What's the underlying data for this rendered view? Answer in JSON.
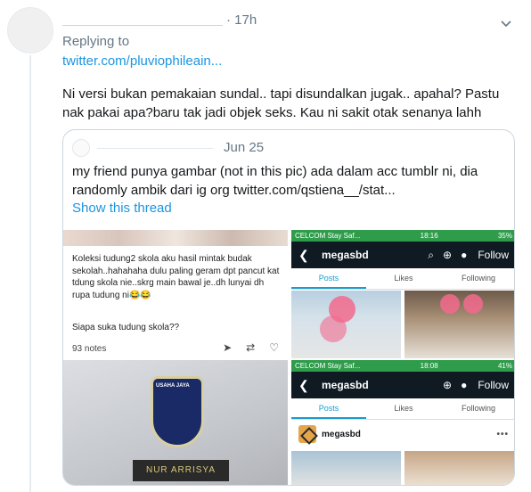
{
  "tweet": {
    "time": "· 17h",
    "replying_label": "Replying to",
    "reply_link": "twitter.com/pluviophileain...",
    "text": "Ni versi bukan pemakaian sundal.. tapi disundalkan jugak.. apahal? Pastu nak pakai apa?baru tak jadi objek seks. Kau ni sakit otak senanya lahh"
  },
  "quote": {
    "date": "Jun 25",
    "text": "my friend punya gambar (not in this pic) ada dalam acc tumblr ni, dia randomly ambik dari ig org  twitter.com/qstiena__/stat...",
    "show_thread": "Show this thread"
  },
  "tumblr": {
    "post": "Koleksi tudung2 skola aku hasil mintak budak sekolah..hahahaha dulu paling geram dpt pancut kat tdung skola nie..skrg main bawal je..dh lunyai dh rupa tudung ni😂😂",
    "question": "Siapa suka tudung skola??",
    "notes": "93 notes"
  },
  "phone_top": {
    "carrier": "CELCOM Stay Saf...",
    "time": "18:16",
    "battery": "35%",
    "username": "megasbd",
    "follow": "Follow",
    "tabs": [
      "Posts",
      "Likes",
      "Following"
    ]
  },
  "phone_bottom": {
    "carrier": "CELCOM Stay Saf...",
    "time": "18:08",
    "battery": "41%",
    "username": "megasbd",
    "follow": "Follow",
    "tabs": [
      "Posts",
      "Likes",
      "Following"
    ],
    "profile_name": "megasbd",
    "more": "•••"
  },
  "badge": {
    "school": "USAHA JAYA",
    "nametag": "NUR ARRISYA"
  },
  "icons": {
    "chevron": "chevron-down-icon",
    "share": "share-icon",
    "reblog": "reblog-icon",
    "like": "heart-icon"
  },
  "colors": {
    "link": "#1b95e0",
    "muted": "#657786",
    "statusbar": "#2e9c4a",
    "appbar": "#0f1a22",
    "tab_active": "#1b9bd1"
  }
}
